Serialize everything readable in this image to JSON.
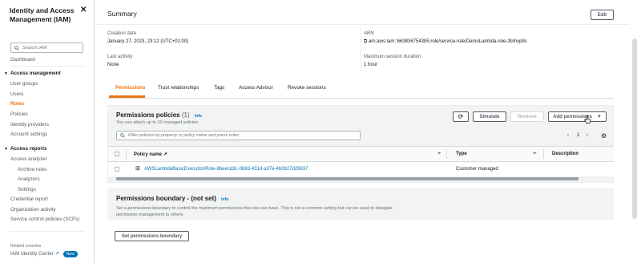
{
  "sidebar": {
    "title": "Identity and Access Management (IAM)",
    "search_placeholder": "Search IAM",
    "dashboard": "Dashboard",
    "access_management": {
      "label": "Access management",
      "items": [
        "User groups",
        "Users",
        "Roles",
        "Policies",
        "Identity providers",
        "Account settings"
      ],
      "active": "Roles"
    },
    "access_reports": {
      "label": "Access reports",
      "items": [
        "Access analyzer",
        "Archive rules",
        "Analyzers",
        "Settings",
        "Credential report",
        "Organization activity",
        "Service control policies (SCPs)"
      ]
    },
    "related_consoles": "Related consoles",
    "identity_center": "IAM Identity Center",
    "new_badge": "New"
  },
  "summary": {
    "title": "Summary",
    "edit_label": "Edit",
    "creation_date_label": "Creation date",
    "creation_date_value": "January 27, 2023, 23:12 (UTC+01:00)",
    "last_activity_label": "Last activity",
    "last_activity_value": "None",
    "arn_label": "ARN",
    "arn_value": "arn:aws:iam::663836754385:role/service-role/DemoLambda-role-3tnhxp9c",
    "max_session_label": "Maximum session duration",
    "max_session_value": "1 hour"
  },
  "tabs": [
    "Permissions",
    "Trust relationships",
    "Tags",
    "Access Advisor",
    "Revoke sessions"
  ],
  "permissions": {
    "title": "Permissions policies",
    "count": "(1)",
    "info": "Info",
    "subtitle": "You can attach up to 10 managed policies.",
    "simulate_label": "Simulate",
    "remove_label": "Remove",
    "add_label": "Add permissions",
    "filter_placeholder": "Filter policies by property or policy name and press enter.",
    "page": "1",
    "columns": [
      "Policy name",
      "Type",
      "Description"
    ],
    "rows": [
      {
        "name": "AWSLambdaBasicExecutionRole-8beecd3c-0b9d-431d-a37e-4b0b27d26637",
        "type": "Customer managed",
        "description": ""
      }
    ]
  },
  "boundary": {
    "title": "Permissions boundary - (not set)",
    "info": "Info",
    "description": "Set a permissions boundary to control the maximum permissions this role can have. This is not a common setting but can be used to delegate permission management to others.",
    "button_label": "Set permissions boundary"
  },
  "colors": {
    "accent": "#ec7211",
    "link": "#0073bb"
  }
}
